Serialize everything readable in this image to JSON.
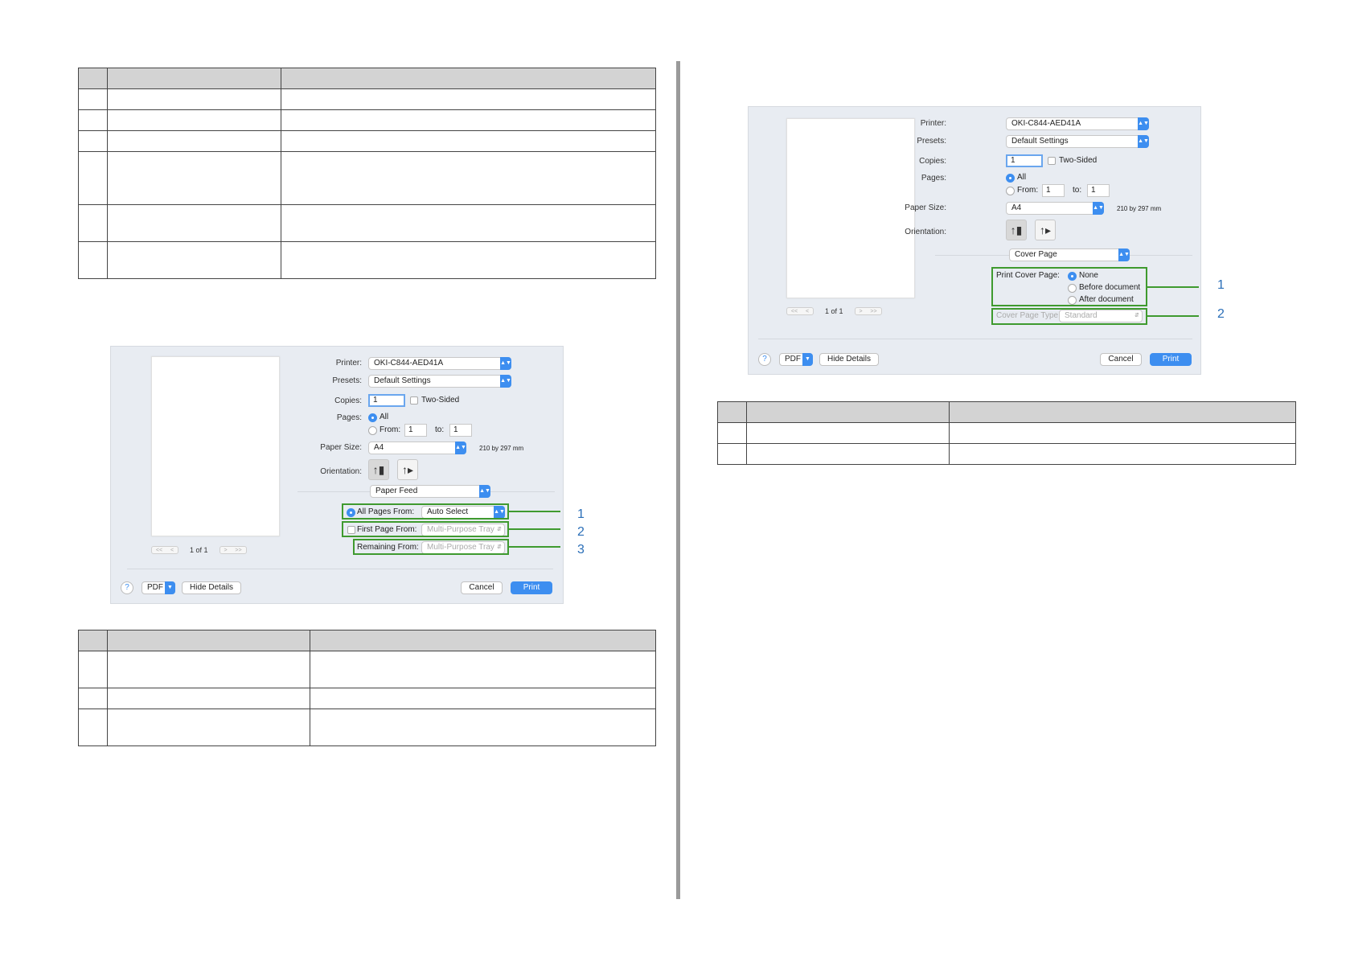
{
  "left_dialog": {
    "printer_label": "Printer:",
    "printer_value": "OKI-C844-AED41A",
    "presets_label": "Presets:",
    "presets_value": "Default Settings",
    "copies_label": "Copies:",
    "copies_value": "1",
    "two_sided_label": "Two-Sided",
    "pages_label": "Pages:",
    "pages_all_label": "All",
    "pages_from_label": "From:",
    "pages_from_value": "1",
    "pages_to_label": "to:",
    "pages_to_value": "1",
    "paper_size_label": "Paper Size:",
    "paper_size_value": "A4",
    "paper_dimensions": "210 by 297 mm",
    "orientation_label": "Orientation:",
    "section_value": "Paper Feed",
    "all_pages_from_label": "All Pages From:",
    "all_pages_from_value": "Auto Select",
    "first_page_from_label": "First Page From:",
    "first_page_from_value": "Multi-Purpose Tray",
    "remaining_from_label": "Remaining From:",
    "remaining_from_value": "Multi-Purpose Tray",
    "page_count": "1 of 1",
    "help_glyph": "?",
    "pdf_label": "PDF",
    "hide_details_label": "Hide Details",
    "cancel_label": "Cancel",
    "print_label": "Print",
    "callouts": [
      "1",
      "2",
      "3"
    ]
  },
  "right_dialog": {
    "printer_label": "Printer:",
    "printer_value": "OKI-C844-AED41A",
    "presets_label": "Presets:",
    "presets_value": "Default Settings",
    "copies_label": "Copies:",
    "copies_value": "1",
    "two_sided_label": "Two-Sided",
    "pages_label": "Pages:",
    "pages_all_label": "All",
    "pages_from_label": "From:",
    "pages_from_value": "1",
    "pages_to_label": "to:",
    "pages_to_value": "1",
    "paper_size_label": "Paper Size:",
    "paper_size_value": "A4",
    "paper_dimensions": "210 by 297 mm",
    "orientation_label": "Orientation:",
    "section_value": "Cover Page",
    "print_cover_page_label": "Print Cover Page:",
    "cover_none_label": "None",
    "cover_before_label": "Before document",
    "cover_after_label": "After document",
    "cover_page_type_label": "Cover Page Type:",
    "cover_page_type_value": "Standard",
    "page_count": "1 of 1",
    "help_glyph": "?",
    "pdf_label": "PDF",
    "hide_details_label": "Hide Details",
    "cancel_label": "Cancel",
    "print_label": "Print",
    "callouts": [
      "1",
      "2"
    ]
  },
  "icons": {
    "portrait": "portrait-orientation-icon",
    "landscape": "landscape-orientation-icon",
    "popup_arrows": "up-down-chevron-icon",
    "help": "question-mark-icon"
  },
  "colors": {
    "highlight_box": "#3f9a2f",
    "callout_text": "#2b6fb8",
    "accent": "#3d8ef0",
    "table_header": "#d3d3d3",
    "dialog_bg": "#e8ecf2"
  }
}
